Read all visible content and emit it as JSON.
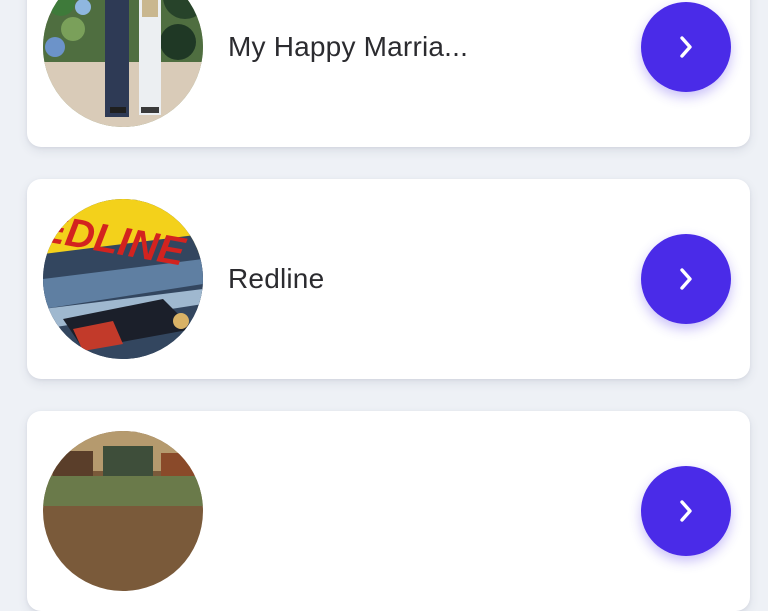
{
  "items": [
    {
      "title": "My Happy Marria...",
      "poster": "my-happy-marriage-poster",
      "action_icon": "chevron-right-icon"
    },
    {
      "title": "Redline",
      "poster": "redline-poster",
      "poster_text": "EDLINE",
      "action_icon": "chevron-right-icon"
    },
    {
      "title": "",
      "poster": "third-title-poster",
      "action_icon": "chevron-right-icon"
    }
  ],
  "colors": {
    "background": "#eef1f6",
    "card": "#ffffff",
    "accent": "#4a2be8",
    "title_text": "#2b2b2f"
  }
}
